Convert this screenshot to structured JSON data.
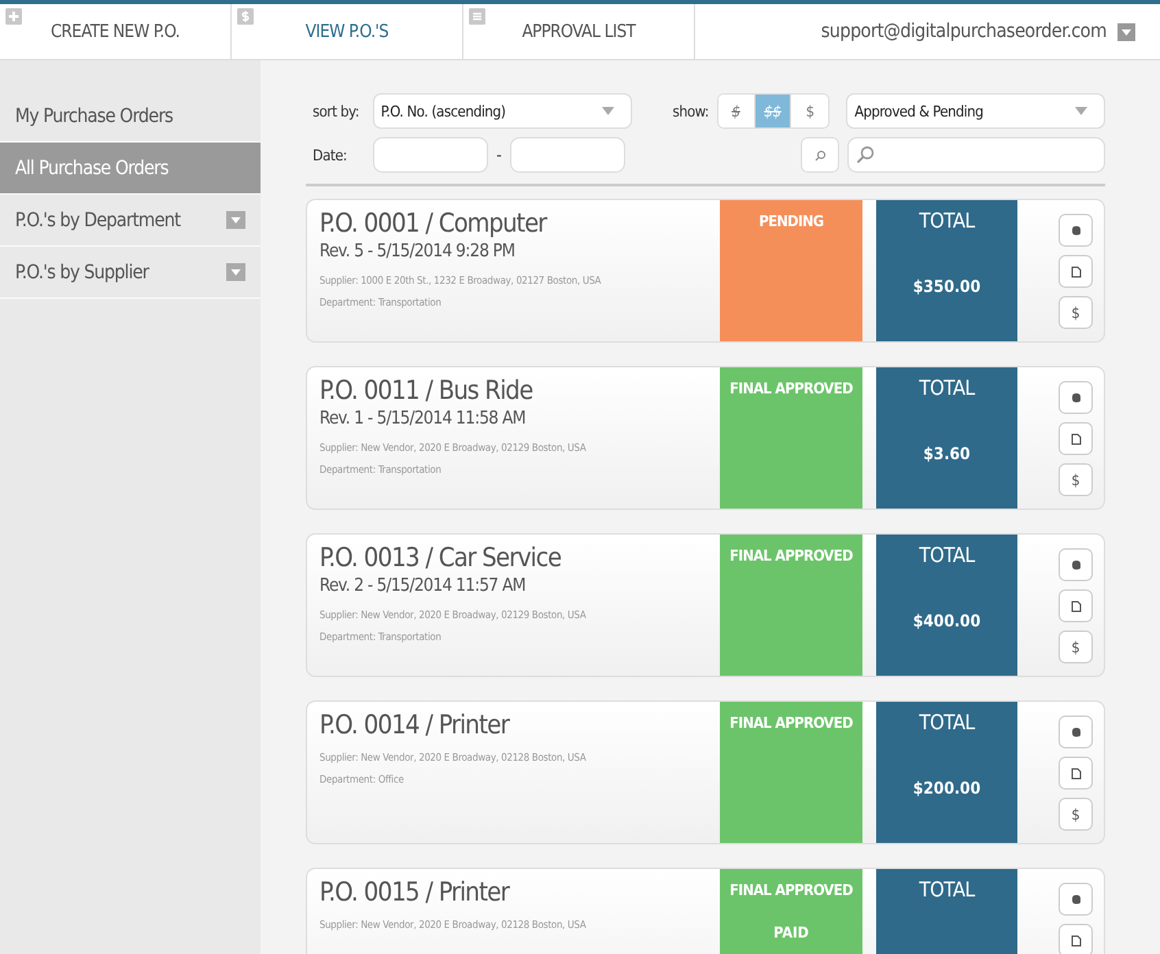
{
  "nav": {
    "tabs": [
      {
        "label": "CREATE NEW P.O.",
        "selected": false
      },
      {
        "label": "VIEW P.O.'S",
        "selected": true
      },
      {
        "label": "APPROVAL LIST",
        "selected": false
      }
    ],
    "account": "support@digitalpurchaseorder.com"
  },
  "sidebar": {
    "items": [
      {
        "label": "My Purchase Orders",
        "selected": false,
        "dropdown": false
      },
      {
        "label": "All Purchase Orders",
        "selected": true,
        "dropdown": false
      },
      {
        "label": "P.O.'s by Department",
        "selected": false,
        "dropdown": true
      },
      {
        "label": "P.O.'s by Supplier",
        "selected": false,
        "dropdown": true
      }
    ]
  },
  "filters": {
    "sort_label": "sort by:",
    "sort_value": "P.O. No. (ascending)",
    "show_label": "show:",
    "show_options": [
      {
        "label": "$",
        "struck": true,
        "selected": false
      },
      {
        "label": "$$",
        "struck": true,
        "selected": true
      },
      {
        "label": "$",
        "struck": false,
        "selected": false
      }
    ],
    "status_value": "Approved & Pending",
    "date_label": "Date:",
    "date_separator": "-"
  },
  "orders": [
    {
      "title": "P.O. 0001 / Computer",
      "revision": "Rev. 5 - 5/15/2014 9:28 PM",
      "supplier": "Supplier: 1000 E 20th St., 1232 E Broadway, 02127 Boston, USA",
      "department": "Department: Transportation",
      "status": "PENDING",
      "color": "#f58f5a",
      "total_label": "TOTAL",
      "total": "$350.00",
      "actions": [
        {
          "kind": "grab"
        },
        {
          "kind": "document"
        },
        {
          "kind": "pay",
          "label": "$"
        }
      ]
    },
    {
      "title": "P.O. 0011 / Bus Ride",
      "revision": "Rev. 1 - 5/15/2014 11:58 AM",
      "supplier": "Supplier: New Vendor, 2020 E Broadway, 02129 Boston, USA",
      "department": "Department: Transportation",
      "status": "FINAL APPROVED",
      "color": "#6cc46a",
      "total_label": "TOTAL",
      "total": "$3.60",
      "actions": [
        {
          "kind": "grab"
        },
        {
          "kind": "document"
        },
        {
          "kind": "pay",
          "label": "$"
        }
      ]
    },
    {
      "title": "P.O. 0013 / Car Service",
      "revision": "Rev. 2 - 5/15/2014 11:57 AM",
      "supplier": "Supplier: New Vendor, 2020 E Broadway, 02129 Boston, USA",
      "department": "Department: Transportation",
      "status": "FINAL APPROVED",
      "color": "#6cc46a",
      "total_label": "TOTAL",
      "total": "$400.00",
      "actions": [
        {
          "kind": "grab"
        },
        {
          "kind": "document"
        },
        {
          "kind": "pay",
          "label": "$"
        }
      ]
    },
    {
      "title": "P.O. 0014 / Printer",
      "supplier": "Supplier: New Vendor, 2020 E Broadway, 02128 Boston, USA",
      "department": "Department: Office",
      "status": "FINAL APPROVED",
      "color": "#6cc46a",
      "total_label": "TOTAL",
      "total": "$200.00",
      "actions": [
        {
          "kind": "grab"
        },
        {
          "kind": "document"
        },
        {
          "kind": "pay",
          "label": "$"
        }
      ]
    },
    {
      "title": "P.O. 0015 / Printer",
      "supplier": "Supplier: New Vendor, 2020 E Broadway, 02128 Boston, USA",
      "status": "FINAL APPROVED",
      "status_note": "PAID",
      "color": "#6cc46a",
      "total_label": "TOTAL",
      "actions": [
        {
          "kind": "grab"
        },
        {
          "kind": "document"
        }
      ]
    }
  ]
}
